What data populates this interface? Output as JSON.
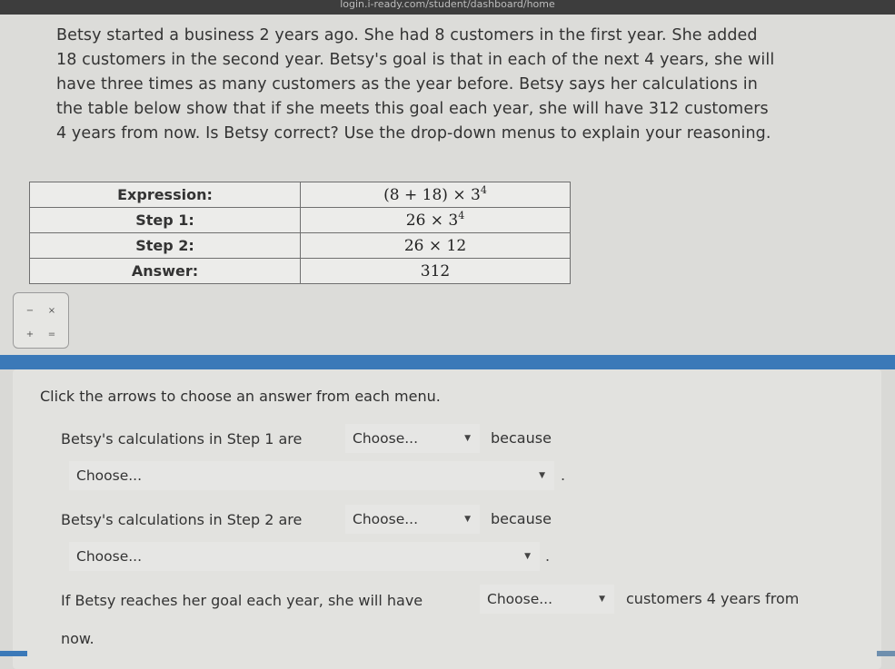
{
  "browser": {
    "url": "login.i-ready.com/student/dashboard/home"
  },
  "question": {
    "line1": "Betsy started a business 2 years ago. She had 8 customers in the first year. She added",
    "line2": "18 customers in the second year. Betsy's goal is that in each of the next 4 years, she will",
    "line3": "have three times as many customers as the year before. Betsy says her calculations in",
    "line4": "the table below show that if she meets this goal each year, she will have 312 customers",
    "line5": "4 years from now. Is Betsy correct? Use the drop-down menus to explain your reasoning."
  },
  "table": {
    "rows": [
      {
        "label": "Expression:",
        "value": "(8 + 18) × 3",
        "exp": "4"
      },
      {
        "label": "Step 1:",
        "value": "26 × 3",
        "exp": "4"
      },
      {
        "label": "Step 2:",
        "value": "26 × 12",
        "exp": ""
      },
      {
        "label": "Answer:",
        "value": "312",
        "exp": ""
      }
    ]
  },
  "calculator": {
    "minus": "−",
    "times": "×",
    "plus": "+",
    "equals": "="
  },
  "answer": {
    "instructions": "Click the arrows to choose an answer from each menu.",
    "s1_prefix": "Betsy's calculations in Step 1 are",
    "s1_because": "because",
    "s2_prefix": "Betsy's calculations in Step 2 are",
    "s2_because": "because",
    "s3_prefix": "If Betsy reaches her goal each year, she will have",
    "s3_suffix": "customers 4 years from",
    "s3_end": "now.",
    "period": ".",
    "dropdown_placeholder": "Choose...",
    "arrow": "▼"
  }
}
